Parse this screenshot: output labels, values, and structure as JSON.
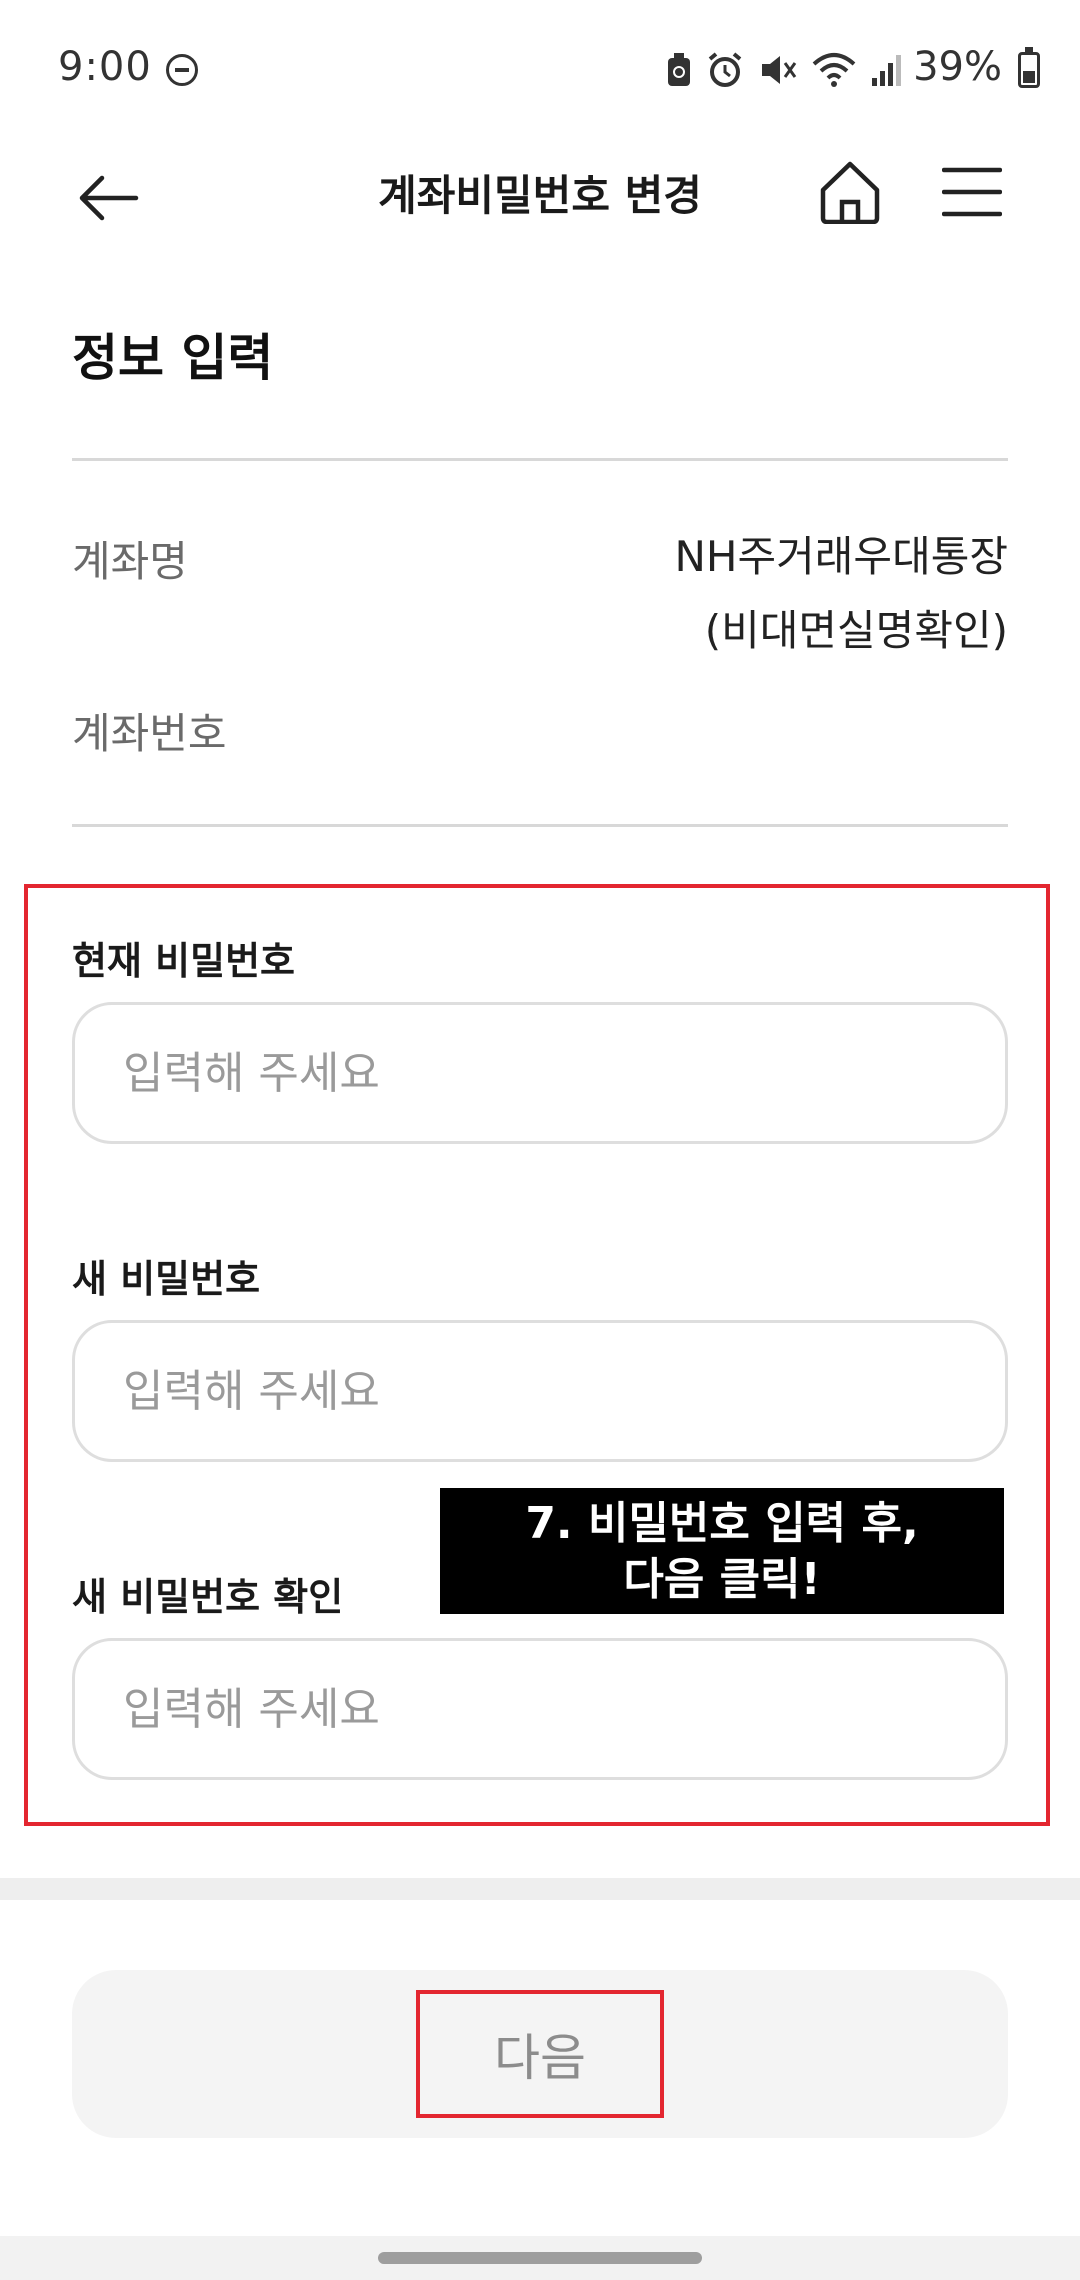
{
  "status_bar": {
    "time": "9:00",
    "battery_percent": "39%",
    "icons": [
      "dnd-icon",
      "sim-icon",
      "alarm-icon",
      "mute-icon",
      "wifi-icon",
      "signal-icon",
      "battery-icon"
    ]
  },
  "header": {
    "title": "계좌비밀번호 변경",
    "back_icon": "back-arrow-icon",
    "home_icon": "home-icon",
    "menu_icon": "menu-icon"
  },
  "section": {
    "title": "정보 입력"
  },
  "account_info": {
    "name_label": "계좌명",
    "name_value_line1": "NH주거래우대통장",
    "name_value_line2": "(비대면실명확인)",
    "number_label": "계좌번호",
    "number_value": ""
  },
  "form": {
    "current_password": {
      "label": "현재 비밀번호",
      "placeholder": "입력해 주세요",
      "value": ""
    },
    "new_password": {
      "label": "새 비밀번호",
      "placeholder": "입력해 주세요",
      "value": ""
    },
    "confirm_password": {
      "label": "새 비밀번호 확인",
      "placeholder": "입력해 주세요",
      "value": ""
    }
  },
  "annotation": {
    "line1": "7. 비밀번호 입력 후,",
    "line2": "다음 클릭!"
  },
  "footer": {
    "next_label": "다음"
  },
  "colors": {
    "highlight": "#e32630",
    "annotation_bg": "#000000",
    "button_bg": "#f4f4f4",
    "button_text": "#8c8c8c"
  }
}
